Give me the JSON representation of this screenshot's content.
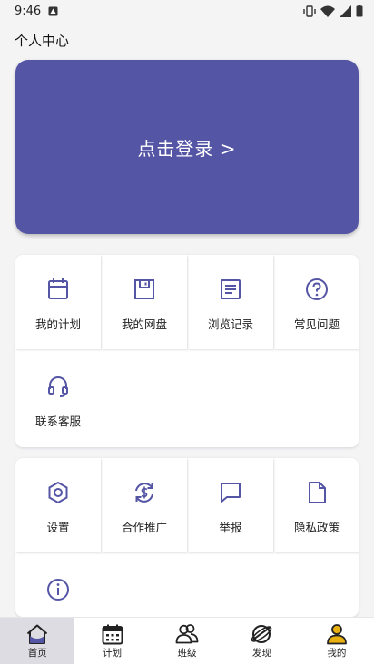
{
  "status_bar": {
    "time": "9:46"
  },
  "header": {
    "title": "个人中心"
  },
  "login": {
    "label": "点击登录 >"
  },
  "section1": {
    "items": [
      {
        "label": "我的计划",
        "icon": "calendar-icon"
      },
      {
        "label": "我的网盘",
        "icon": "floppy-disk-icon"
      },
      {
        "label": "浏览记录",
        "icon": "document-icon"
      },
      {
        "label": "常见问题",
        "icon": "help-circle-icon"
      },
      {
        "label": "联系客服",
        "icon": "headset-icon"
      }
    ]
  },
  "section2": {
    "items": [
      {
        "label": "设置",
        "icon": "settings-icon"
      },
      {
        "label": "合作推广",
        "icon": "dollar-refresh-icon"
      },
      {
        "label": "举报",
        "icon": "chat-bubble-icon"
      },
      {
        "label": "隐私政策",
        "icon": "file-icon"
      },
      {
        "label": "",
        "icon": "info-icon"
      }
    ]
  },
  "bottom_nav": {
    "items": [
      {
        "label": "首页",
        "icon": "home-icon",
        "active": true
      },
      {
        "label": "计划",
        "icon": "calendar-icon",
        "active": false
      },
      {
        "label": "班级",
        "icon": "group-icon",
        "active": false
      },
      {
        "label": "发现",
        "icon": "planet-icon",
        "active": false
      },
      {
        "label": "我的",
        "icon": "person-icon",
        "active": false
      }
    ]
  },
  "colors": {
    "accent": "#5555a6",
    "nav_active_bg": "#dcdce2",
    "profile_icon_accent": "#e8b010"
  }
}
